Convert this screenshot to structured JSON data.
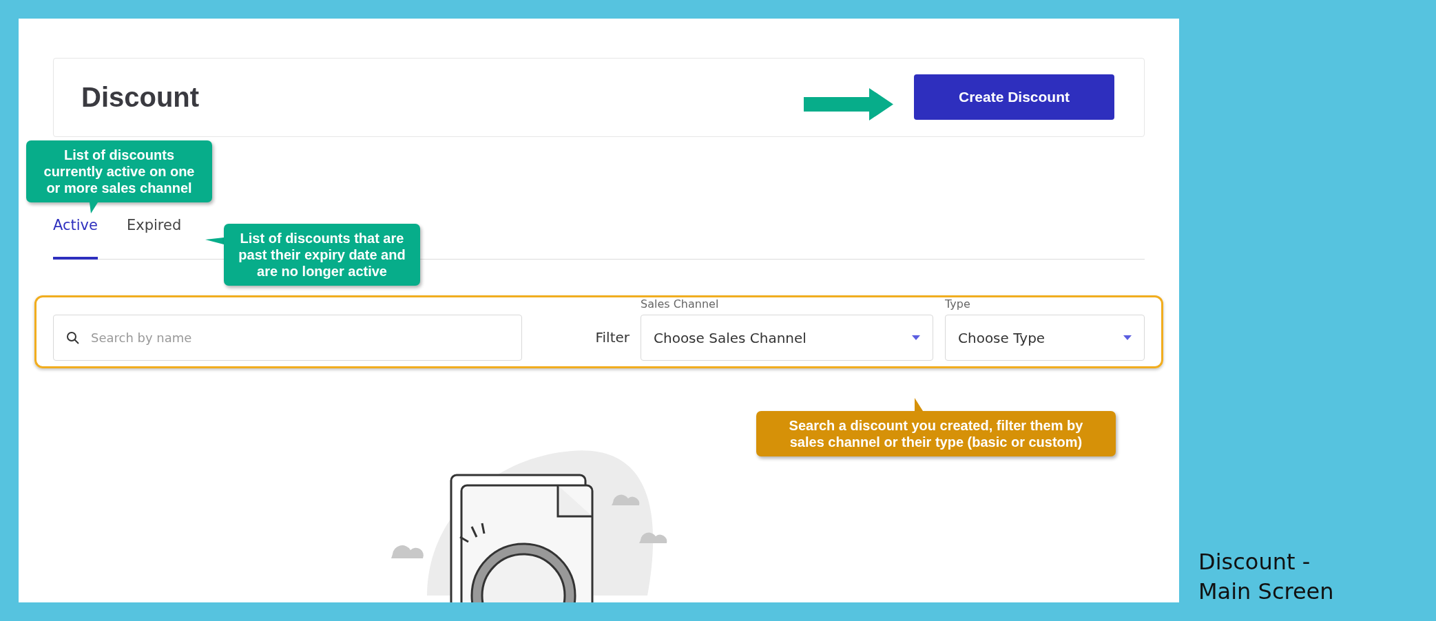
{
  "header": {
    "title": "Discount",
    "create_button": "Create Discount"
  },
  "tabs": [
    {
      "label": "Active",
      "selected": true
    },
    {
      "label": "Expired",
      "selected": false
    }
  ],
  "filters": {
    "search": {
      "placeholder": "Search by name"
    },
    "filter_label": "Filter",
    "selects": [
      {
        "label": "Sales Channel",
        "value": "Choose Sales Channel"
      },
      {
        "label": "Type",
        "value": "Choose Type"
      }
    ]
  },
  "annotations": [
    {
      "text": "List of discounts currently active on one or more sales channel",
      "color": "#07ad8a"
    },
    {
      "text": "List of discounts that are past their expiry date and are no longer active",
      "color": "#07ad8a"
    },
    {
      "text": "Search a discount you created, filter them by sales channel or their type (basic or custom)",
      "color": "#d69108"
    }
  ],
  "caption": "Discount - Main Screen"
}
